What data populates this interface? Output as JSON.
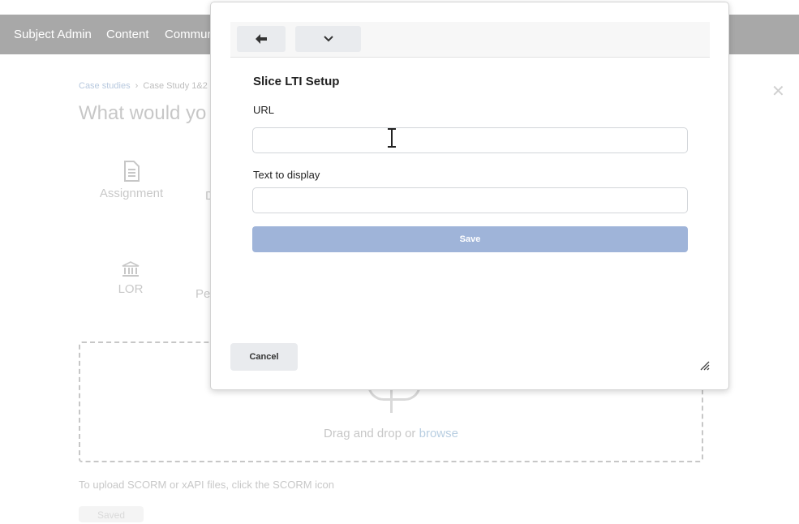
{
  "topnav": {
    "items": [
      {
        "label": "Subject Admin"
      },
      {
        "label": "Content"
      },
      {
        "label": "Commun"
      }
    ]
  },
  "background": {
    "breadcrumb": {
      "item1": "Case studies",
      "separator": "›",
      "item2": "Case Study 1&2"
    },
    "title": "What would yo",
    "close_icon": "close-icon",
    "tiles": {
      "assignment": {
        "label": "Assignment",
        "icon": "document-icon"
      },
      "partial_d": "D",
      "lor": {
        "label": "LOR",
        "icon": "bank-icon"
      },
      "partial_pe": "Pe"
    },
    "dropzone": {
      "text": "Drag and drop or ",
      "link": "browse",
      "icon": "upload-icon"
    },
    "scorm_hint": "To upload SCORM or xAPI files, click the SCORM icon",
    "button_label": "Saved"
  },
  "modal": {
    "close_icon": "close-icon",
    "toolbar": {
      "back_icon": "arrow-left-icon",
      "dropdown_icon": "chevron-down-icon"
    },
    "title": "Slice LTI Setup",
    "url_label": "URL",
    "url_value": "",
    "text_label": "Text to display",
    "text_value": "",
    "save_label": "Save",
    "cancel_label": "Cancel",
    "resize_icon": "resize-handle-icon"
  },
  "colors": {
    "nav_background": "#a8a8a8",
    "save_button": "#9fb4d9",
    "secondary_button": "#e9ebee",
    "link": "#7ea6c9"
  }
}
